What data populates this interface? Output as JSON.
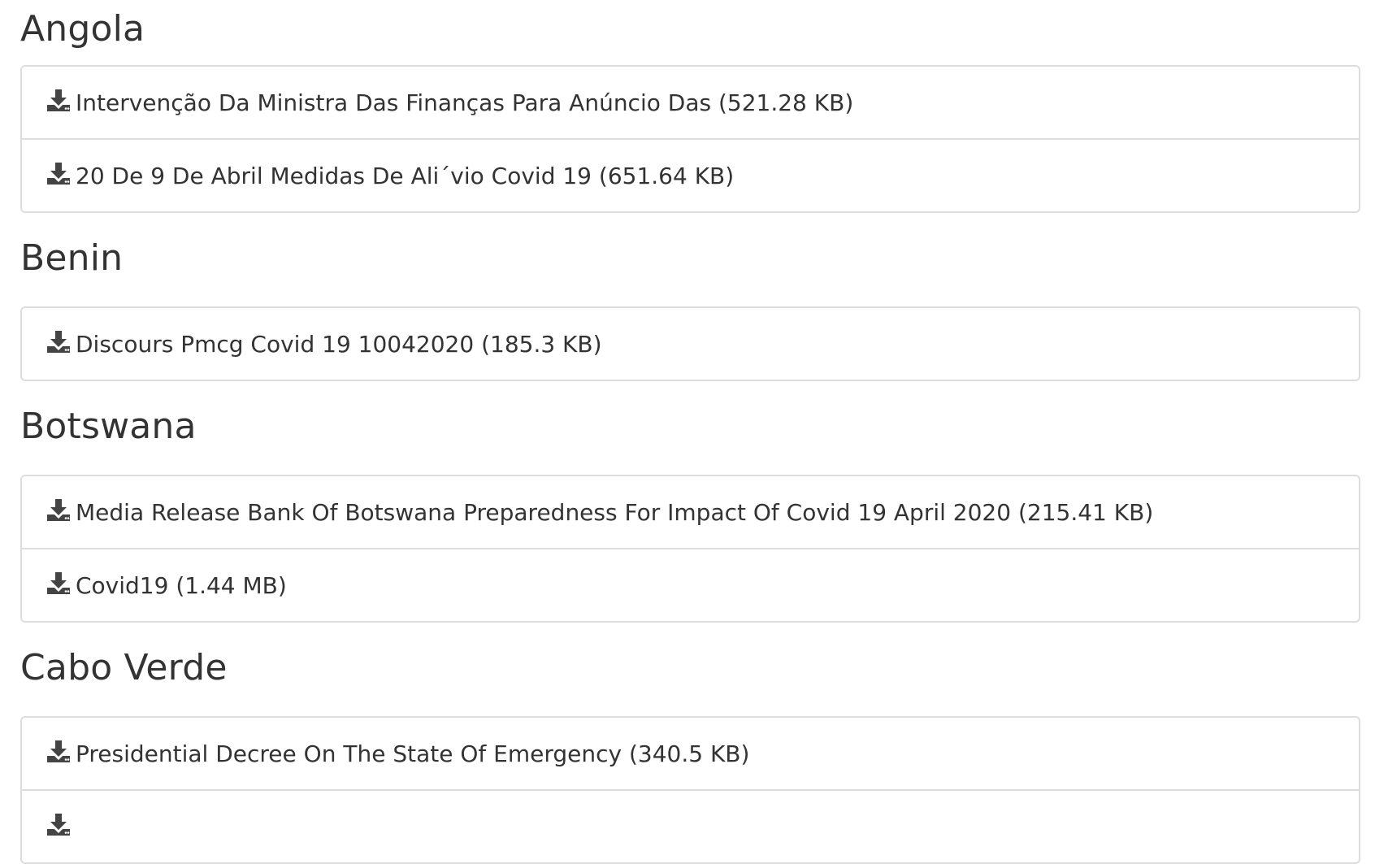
{
  "sections": [
    {
      "country": "Angola",
      "files": [
        {
          "label": "Intervenção Da Ministra Das Finanças Para Anúncio Das (521.28 KB)"
        },
        {
          "label": "20 De 9 De Abril Medidas De Ali´vio Covid 19 (651.64 KB)"
        }
      ]
    },
    {
      "country": "Benin",
      "files": [
        {
          "label": "Discours Pmcg Covid 19 10042020 (185.3 KB)"
        }
      ]
    },
    {
      "country": "Botswana",
      "files": [
        {
          "label": "Media Release Bank Of Botswana Preparedness For Impact Of Covid 19 April 2020 (215.41 KB)"
        },
        {
          "label": "Covid19 (1.44 MB)"
        }
      ]
    },
    {
      "country": "Cabo Verde",
      "files": [
        {
          "label": "Presidential Decree On The State Of Emergency (340.5 KB)"
        },
        {
          "label": ""
        }
      ]
    }
  ],
  "icon": "download-icon",
  "colors": {
    "text": "#333333",
    "border": "#dddddd",
    "background": "#ffffff"
  }
}
